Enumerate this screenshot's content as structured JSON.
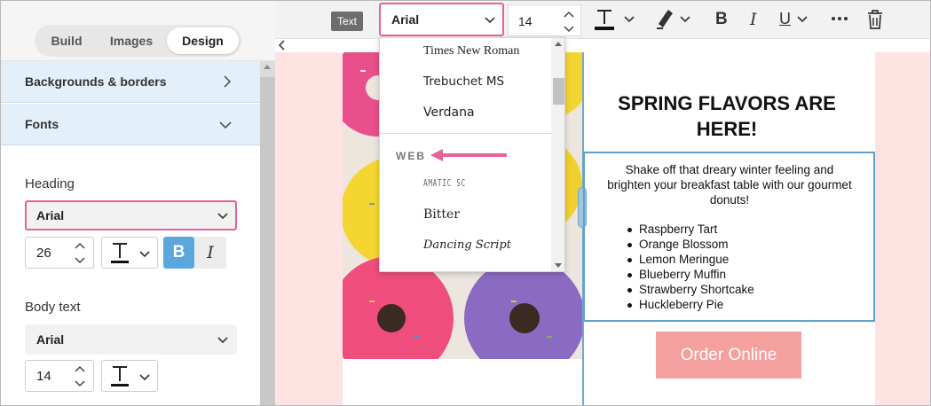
{
  "sidebar": {
    "tabs": [
      {
        "label": "Build"
      },
      {
        "label": "Images"
      },
      {
        "label": "Design",
        "active": true
      }
    ],
    "sections": [
      {
        "label": "Backgrounds & borders",
        "state": "collapsed"
      },
      {
        "label": "Fonts",
        "state": "expanded"
      }
    ],
    "heading": {
      "label": "Heading",
      "font": "Arial",
      "size": "26",
      "bold": true,
      "bold_label": "B",
      "italic_label": "I"
    },
    "body_text": {
      "label": "Body text",
      "font": "Arial",
      "size": "14"
    }
  },
  "toolbar": {
    "block_tag": "Text",
    "font": "Arial",
    "size": "14",
    "icons": [
      "text-color-icon",
      "highlight-icon",
      "bold-icon",
      "italic-icon",
      "underline-icon",
      "more-icon",
      "trash-icon"
    ],
    "bold_label": "B",
    "italic_label": "I",
    "underline_label": "U"
  },
  "font_dropdown": {
    "items_top": [
      "Times New Roman",
      "Trebuchet MS",
      "Verdana"
    ],
    "group_heading": "WEB",
    "items_web": [
      "Amatic SC",
      "Bitter",
      "Dancing Script"
    ]
  },
  "email": {
    "heading": "SPRING FLAVORS ARE HERE!",
    "paragraph": "Shake off that dreary winter feeling and brighten your breakfast table with our gourmet donuts!",
    "flavors": [
      "Raspberry Tart",
      "Orange Blossom",
      "Lemon Meringue",
      "Blueberry Muffin",
      "Strawberry Shortcake",
      "Huckleberry Pie"
    ],
    "cta": "Order Online"
  },
  "colors": {
    "highlight_border": "#e8609c",
    "accordion_bg": "#e3eff9",
    "active_toggle": "#5aa7dd",
    "canvas_bg": "#ffe3e3",
    "cta_bg": "#f4a09f",
    "selection_border": "#5fa1cd"
  }
}
